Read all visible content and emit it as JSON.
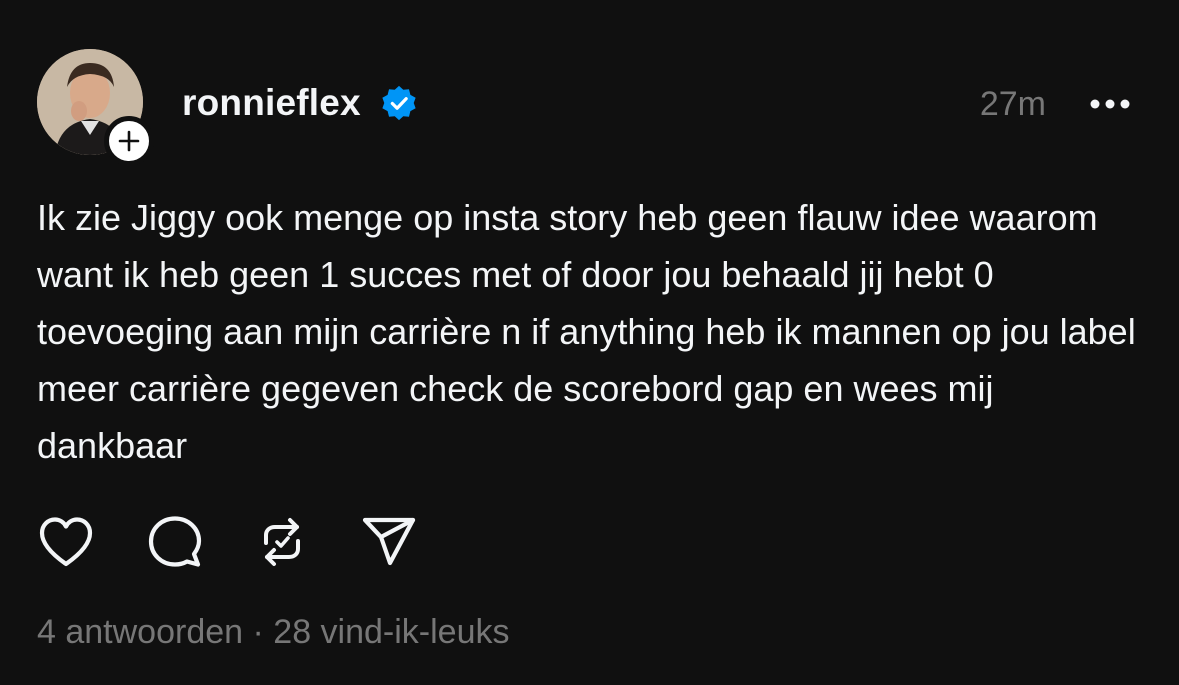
{
  "post": {
    "author": {
      "username": "ronnieflex",
      "verified": true,
      "avatar": "profile-photo"
    },
    "timestamp": "27m",
    "text": "Ik zie Jiggy ook menge op insta story heb geen flauw idee waarom want ik heb geen 1 succes met of door jou behaald jij hebt 0 toevoeging aan mijn carrière n if anything heb ik mannen op jou label meer carrière gegeven check de scorebord gap en wees mij dankbaar",
    "stats": {
      "replies": "4 antwoorden",
      "separator": "·",
      "likes": "28 vind-ik-leuks"
    }
  },
  "icons": {
    "follow": "plus-icon",
    "verified": "verified-badge-icon",
    "more": "more-horizontal-icon",
    "like": "heart-icon",
    "reply": "comment-icon",
    "repost": "repost-icon",
    "share": "send-icon"
  },
  "colors": {
    "background": "#101010",
    "primary_text": "#f3f5f7",
    "secondary_text": "#777777",
    "verified_blue": "#0095f6"
  }
}
